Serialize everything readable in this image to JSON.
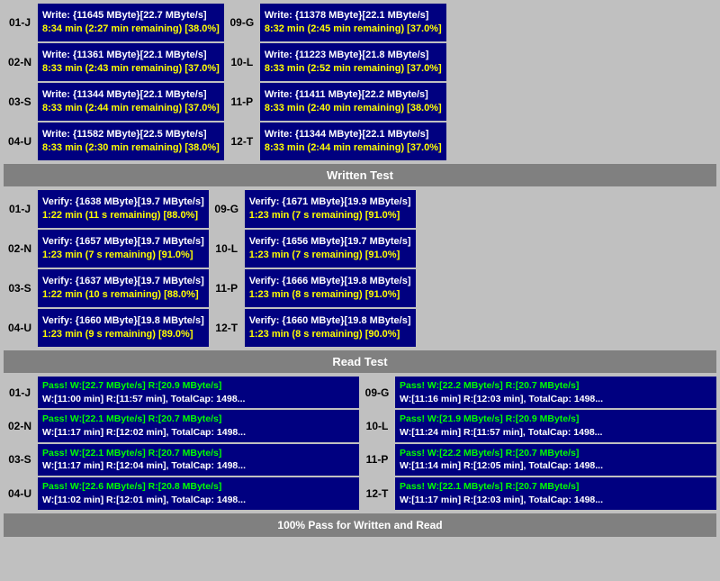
{
  "write_section": {
    "rows": [
      {
        "id": "01-J",
        "left": {
          "line1": "Write: {11645 MByte}[22.7 MByte/s]",
          "line2": "8:34 min (2:27 min remaining)  [38.0%]"
        }
      },
      {
        "id": "02-N",
        "left": {
          "line1": "Write: {11361 MByte}[22.1 MByte/s]",
          "line2": "8:33 min (2:43 min remaining)  [37.0%]"
        }
      },
      {
        "id": "03-S",
        "left": {
          "line1": "Write: {11344 MByte}[22.1 MByte/s]",
          "line2": "8:33 min (2:44 min remaining)  [37.0%]"
        }
      },
      {
        "id": "04-U",
        "left": {
          "line1": "Write: {11582 MByte}[22.5 MByte/s]",
          "line2": "8:33 min (2:30 min remaining)  [38.0%]"
        }
      }
    ],
    "right_rows": [
      {
        "id": "09-G",
        "line1": "Write: {11378 MByte}[22.1 MByte/s]",
        "line2": "8:32 min (2:45 min remaining)  [37.0%]"
      },
      {
        "id": "10-L",
        "line1": "Write: {11223 MByte}[21.8 MByte/s]",
        "line2": "8:33 min (2:52 min remaining)  [37.0%]"
      },
      {
        "id": "11-P",
        "line1": "Write: {11411 MByte}[22.2 MByte/s]",
        "line2": "8:33 min (2:40 min remaining)  [38.0%]"
      },
      {
        "id": "12-T",
        "line1": "Write: {11344 MByte}[22.1 MByte/s]",
        "line2": "8:33 min (2:44 min remaining)  [37.0%]"
      }
    ]
  },
  "written_test_label": "Written Test",
  "verify_section": {
    "left_rows": [
      {
        "id": "01-J",
        "line1": "Verify: {1638 MByte}[19.7 MByte/s]",
        "line2": "1:22 min (11 s remaining)   [88.0%]"
      },
      {
        "id": "02-N",
        "line1": "Verify: {1657 MByte}[19.7 MByte/s]",
        "line2": "1:23 min (7 s remaining)   [91.0%]"
      },
      {
        "id": "03-S",
        "line1": "Verify: {1637 MByte}[19.7 MByte/s]",
        "line2": "1:22 min (10 s remaining)   [88.0%]"
      },
      {
        "id": "04-U",
        "line1": "Verify: {1660 MByte}[19.8 MByte/s]",
        "line2": "1:23 min (9 s remaining)   [89.0%]"
      }
    ],
    "right_rows": [
      {
        "id": "09-G",
        "line1": "Verify: {1671 MByte}[19.9 MByte/s]",
        "line2": "1:23 min (7 s remaining)   [91.0%]"
      },
      {
        "id": "10-L",
        "line1": "Verify: {1656 MByte}[19.7 MByte/s]",
        "line2": "1:23 min (7 s remaining)   [91.0%]"
      },
      {
        "id": "11-P",
        "line1": "Verify: {1666 MByte}[19.8 MByte/s]",
        "line2": "1:23 min (8 s remaining)   [91.0%]"
      },
      {
        "id": "12-T",
        "line1": "Verify: {1660 MByte}[19.8 MByte/s]",
        "line2": "1:23 min (8 s remaining)   [90.0%]"
      }
    ]
  },
  "read_test_label": "Read Test",
  "pass_section": {
    "left_rows": [
      {
        "id": "01-J",
        "line1": "Pass! W:[22.7 MByte/s] R:[20.9 MByte/s]",
        "line2": "W:[11:00 min] R:[11:57 min], TotalCap: 1498..."
      },
      {
        "id": "02-N",
        "line1": "Pass! W:[22.1 MByte/s] R:[20.7 MByte/s]",
        "line2": "W:[11:17 min] R:[12:02 min], TotalCap: 1498..."
      },
      {
        "id": "03-S",
        "line1": "Pass! W:[22.1 MByte/s] R:[20.7 MByte/s]",
        "line2": "W:[11:17 min] R:[12:04 min], TotalCap: 1498..."
      },
      {
        "id": "04-U",
        "line1": "Pass! W:[22.6 MByte/s] R:[20.8 MByte/s]",
        "line2": "W:[11:02 min] R:[12:01 min], TotalCap: 1498..."
      }
    ],
    "right_rows": [
      {
        "id": "09-G",
        "line1": "Pass! W:[22.2 MByte/s] R:[20.7 MByte/s]",
        "line2": "W:[11:16 min] R:[12:03 min], TotalCap: 1498..."
      },
      {
        "id": "10-L",
        "line1": "Pass! W:[21.9 MByte/s] R:[20.9 MByte/s]",
        "line2": "W:[11:24 min] R:[11:57 min], TotalCap: 1498..."
      },
      {
        "id": "11-P",
        "line1": "Pass! W:[22.2 MByte/s] R:[20.7 MByte/s]",
        "line2": "W:[11:14 min] R:[12:05 min], TotalCap: 1498..."
      },
      {
        "id": "12-T",
        "line1": "Pass! W:[22.1 MByte/s] R:[20.7 MByte/s]",
        "line2": "W:[11:17 min] R:[12:03 min], TotalCap: 1498..."
      }
    ]
  },
  "footer_label": "100% Pass for Written and Read"
}
